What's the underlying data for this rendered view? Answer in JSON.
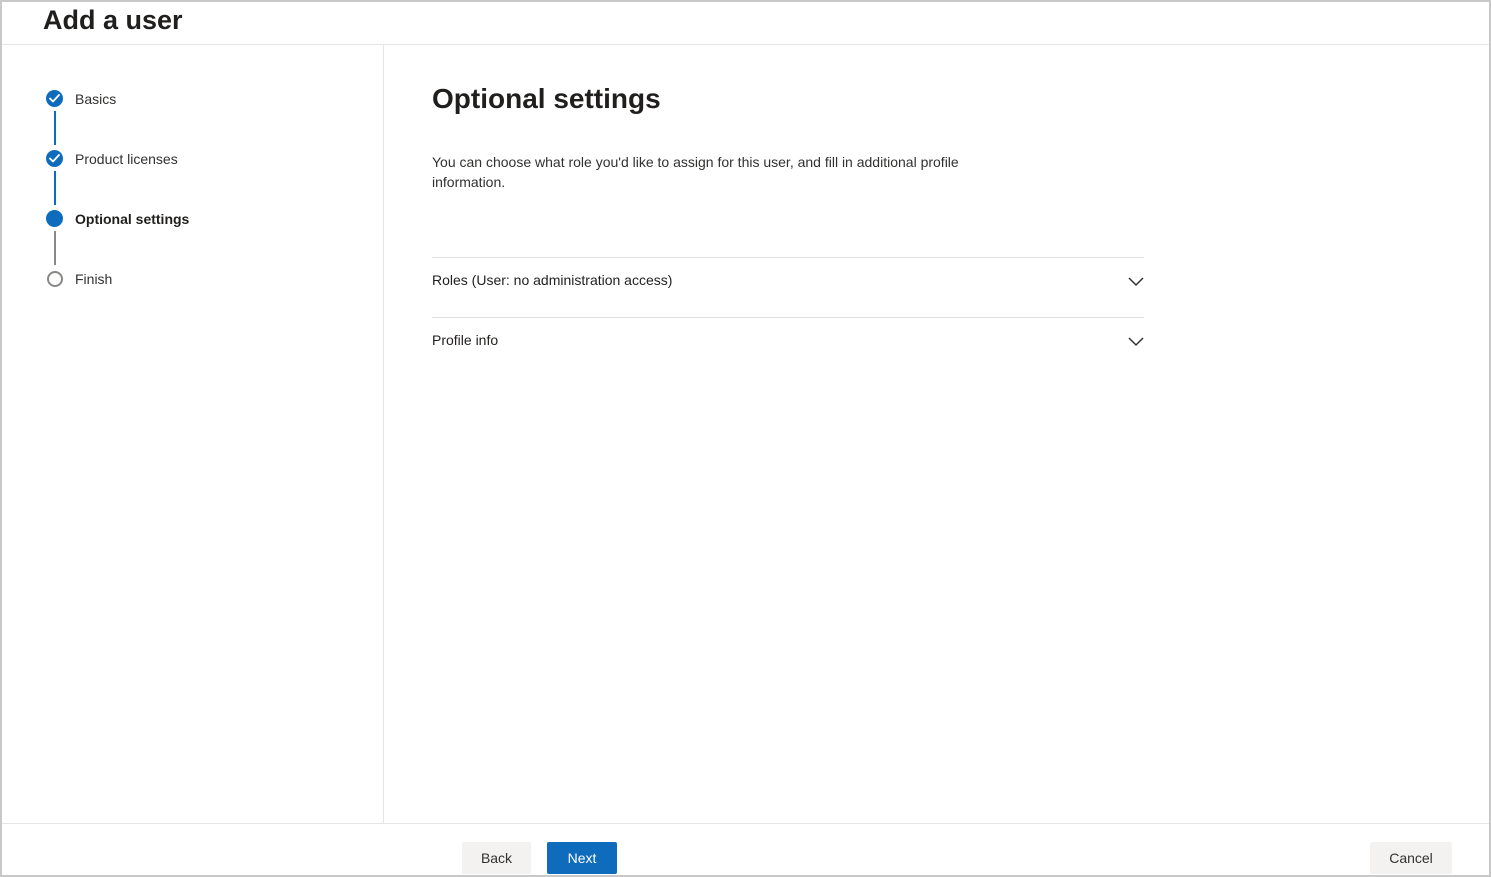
{
  "header": {
    "title": "Add a user"
  },
  "steps": [
    {
      "label": "Basics",
      "state": "done"
    },
    {
      "label": "Product licenses",
      "state": "done"
    },
    {
      "label": "Optional settings",
      "state": "current"
    },
    {
      "label": "Finish",
      "state": "todo"
    }
  ],
  "main": {
    "title": "Optional settings",
    "description": "You can choose what role you'd like to assign for this user, and fill in additional profile information.",
    "sections": [
      {
        "label": "Roles (User: no administration access)",
        "icon": "chevron-down-icon"
      },
      {
        "label": "Profile info",
        "icon": "chevron-down-icon"
      }
    ]
  },
  "footer": {
    "back_label": "Back",
    "next_label": "Next",
    "cancel_label": "Cancel"
  },
  "colors": {
    "accent": "#0f6cbd",
    "pending": "#8a8886"
  }
}
